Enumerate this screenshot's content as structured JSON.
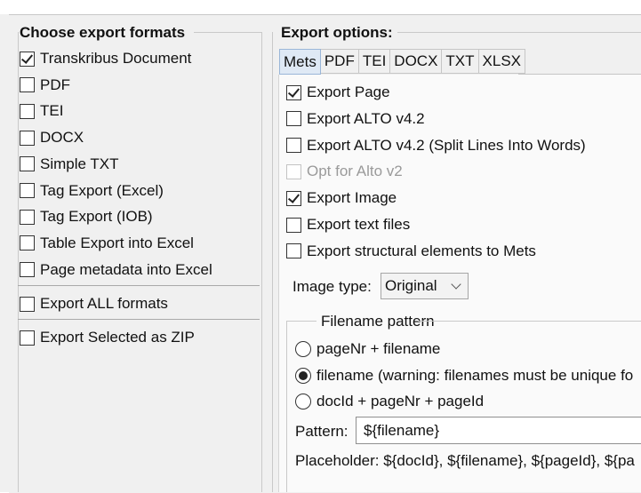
{
  "left_group": {
    "title": "Choose export formats",
    "formats": [
      {
        "label": "Transkribus Document",
        "checked": true
      },
      {
        "label": "PDF",
        "checked": false
      },
      {
        "label": "TEI",
        "checked": false
      },
      {
        "label": "DOCX",
        "checked": false
      },
      {
        "label": "Simple TXT",
        "checked": false
      },
      {
        "label": "Tag Export (Excel)",
        "checked": false
      },
      {
        "label": "Tag Export (IOB)",
        "checked": false
      },
      {
        "label": "Table Export into Excel",
        "checked": false
      },
      {
        "label": "Page metadata into Excel",
        "checked": false
      }
    ],
    "export_all": {
      "label": "Export ALL formats",
      "checked": false
    },
    "export_zip": {
      "label": "Export Selected as ZIP",
      "checked": false
    }
  },
  "right_group": {
    "title": "Export options:",
    "tabs": [
      "Mets",
      "PDF",
      "TEI",
      "DOCX",
      "TXT",
      "XLSX"
    ],
    "active_tab": "Mets",
    "options": [
      {
        "label": "Export Page",
        "checked": true,
        "disabled": false
      },
      {
        "label": "Export ALTO v4.2",
        "checked": false,
        "disabled": false
      },
      {
        "label": "Export ALTO v4.2 (Split Lines Into Words)",
        "checked": false,
        "disabled": false
      },
      {
        "label": "Opt for Alto v2",
        "checked": false,
        "disabled": true
      },
      {
        "label": "Export Image",
        "checked": true,
        "disabled": false
      },
      {
        "label": "Export text files",
        "checked": false,
        "disabled": false
      },
      {
        "label": "Export structural elements to Mets",
        "checked": false,
        "disabled": false
      }
    ],
    "image_type": {
      "label": "Image type:",
      "value": "Original"
    },
    "filename_pattern": {
      "title": "Filename pattern",
      "options": [
        {
          "label": "pageNr + filename",
          "selected": false
        },
        {
          "label": "filename (warning: filenames must be unique fo",
          "selected": true
        },
        {
          "label": "docId + pageNr + pageId",
          "selected": false
        }
      ],
      "pattern_label": "Pattern:",
      "pattern_value": "${filename}",
      "placeholder_text": "Placeholder: ${docId}, ${filename}, ${pageId}, ${pa"
    }
  },
  "colors": {
    "dialog_bg": "#f0f0f0",
    "active_tab_bg": "#dfe9f5",
    "border": "#c9c9c9"
  }
}
